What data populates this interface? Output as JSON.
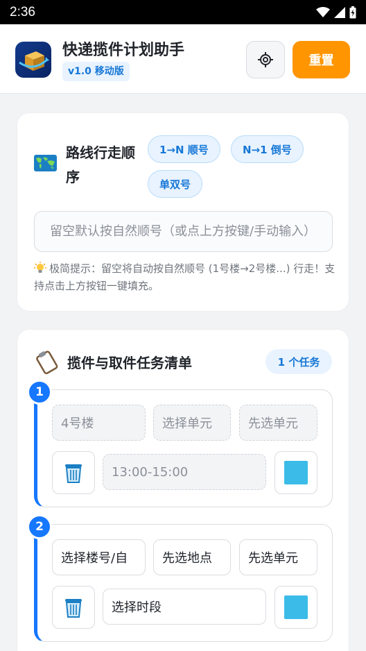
{
  "status_bar": {
    "time": "2:36"
  },
  "header": {
    "title": "快递揽件计划助手",
    "version": "v1.0 移动版",
    "reset_label": "重置"
  },
  "route": {
    "title": "路线行走顺序",
    "chips": [
      "1→N 顺号",
      "N→1 倒号",
      "单双号"
    ],
    "input_placeholder": "留空默认按自然顺号（或点上方按键/手动输入）",
    "tip": "极简提示：留空将自动按自然顺号 (1号楼→2号楼...) 行走！支持点击上方按钮一键填充。"
  },
  "tasks": {
    "title": "揽件与取件任务清单",
    "count": "1 个任务",
    "items": [
      {
        "index": "1",
        "building": "4号楼",
        "unit": "选择单元",
        "sub_unit": "先选单元",
        "time": "13:00-15:00",
        "color": "#3bbbe8",
        "building_disabled": true
      },
      {
        "index": "2",
        "building": "选择楼号/自",
        "unit": "先选地点",
        "sub_unit": "先选单元",
        "time": "选择时段",
        "color": "#3bbbe8",
        "building_disabled": false
      }
    ]
  }
}
